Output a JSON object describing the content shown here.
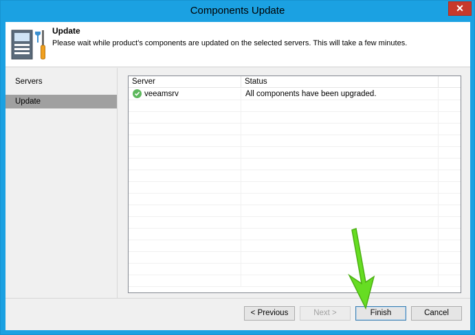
{
  "window": {
    "title": "Components Update",
    "close_glyph": "✕"
  },
  "header": {
    "title": "Update",
    "description": "Please wait while product’s components are updated on the selected servers. This will take a few minutes.",
    "icon": "server-tools-icon"
  },
  "nav": {
    "items": [
      {
        "label": "Servers",
        "selected": false
      },
      {
        "label": "Update",
        "selected": true
      }
    ]
  },
  "grid": {
    "columns": [
      "Server",
      "Status"
    ],
    "rows": [
      {
        "server": "veeamsrv",
        "status": "All components have been upgraded.",
        "icon": "success-check-icon"
      }
    ]
  },
  "buttons": {
    "previous": "< Previous",
    "next": "Next >",
    "finish": "Finish",
    "cancel": "Cancel"
  },
  "colors": {
    "titlebar": "#1ba1e2",
    "close": "#c7392b",
    "selection": "#a0a0a0",
    "success": "#5cb85c",
    "annotation_arrow": "#66dd22"
  }
}
